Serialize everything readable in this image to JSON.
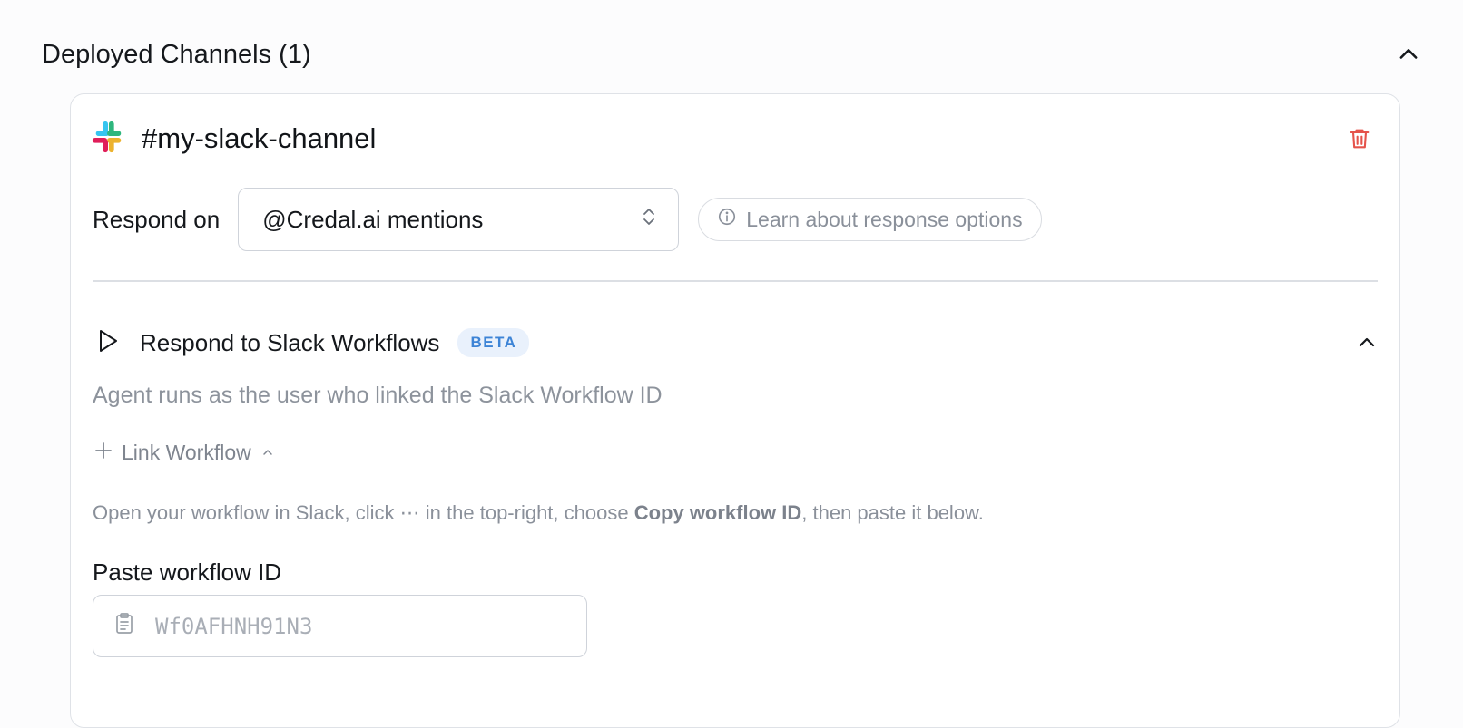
{
  "section": {
    "title": "Deployed Channels (1)",
    "collapse_icon": "chevron-up-icon"
  },
  "channel": {
    "icon": "slack-logo",
    "name": "#my-slack-channel",
    "delete_icon": "trash-icon",
    "delete_color": "#e5534b"
  },
  "respond": {
    "label": "Respond on",
    "selected": "@Credal.ai mentions",
    "select_icon": "chevron-up-down-icon",
    "learn_label": "Learn about response options",
    "learn_icon": "info-icon"
  },
  "workflows": {
    "icon": "play-icon",
    "title": "Respond to Slack Workflows",
    "badge": "BETA",
    "badge_color": "#3d84d6",
    "collapse_icon": "chevron-up-icon",
    "description": "Agent runs as the user who linked the Slack Workflow ID",
    "link_label": "Link Workflow",
    "instructions": {
      "part1": "Open your workflow in Slack, click ",
      "dots": "⋯",
      "part2": " in the top-right, choose ",
      "bold": "Copy workflow ID",
      "part3": ", then paste it below."
    },
    "paste_label": "Paste workflow ID",
    "paste_placeholder": "Wf0AFHNH91N3",
    "paste_value": ""
  }
}
